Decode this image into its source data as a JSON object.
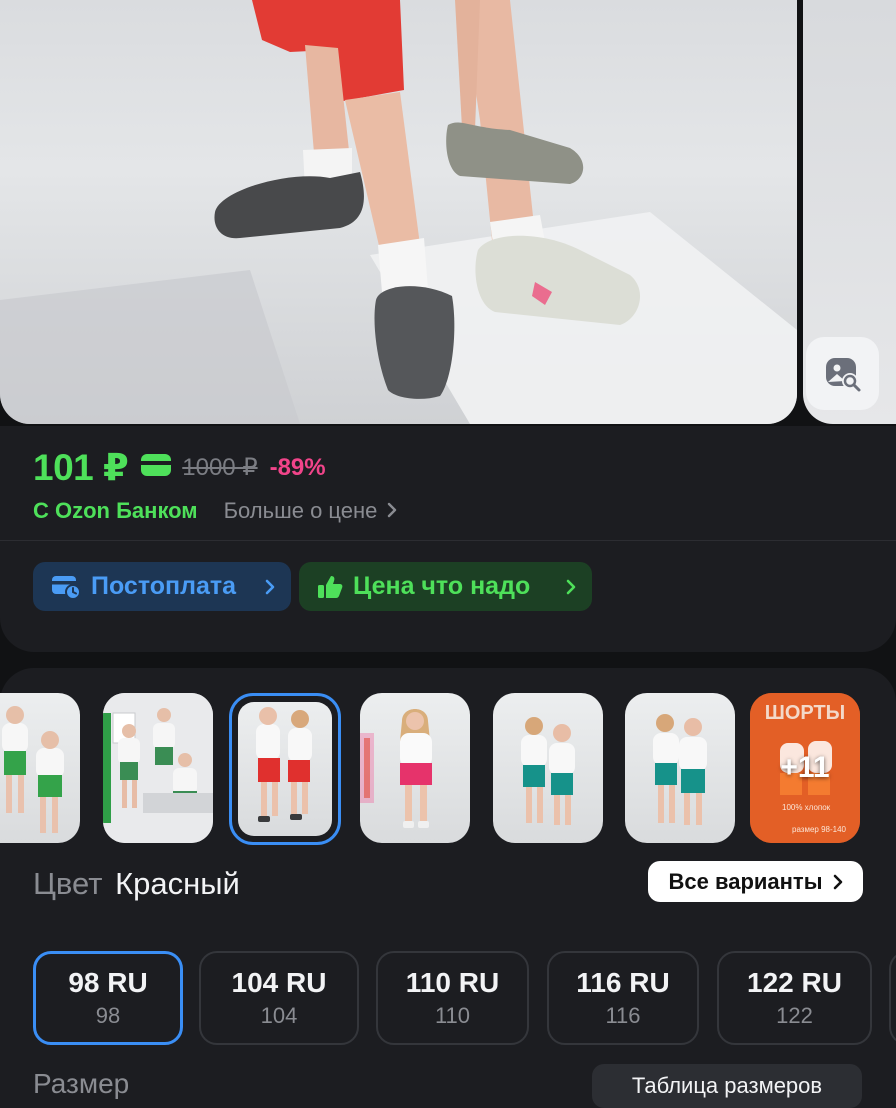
{
  "price": {
    "current": "101 ₽",
    "old": "1000 ₽",
    "discount": "-89%",
    "bank_label": "С Ozon Банком",
    "more_link": "Больше о цене"
  },
  "chips": {
    "postpay": "Постоплата",
    "good_price": "Цена что надо"
  },
  "variants": {
    "more_count": "+11",
    "promo_title": "ШОРТЫ",
    "promo_note1": "100% хлопок",
    "promo_note2": "размер 98-140",
    "color_label": "Цвет",
    "color_value": "Красный",
    "all_variants": "Все варианты"
  },
  "sizes": [
    {
      "main": "98 RU",
      "sub": "98",
      "selected": true
    },
    {
      "main": "104 RU",
      "sub": "104"
    },
    {
      "main": "110 RU",
      "sub": "110"
    },
    {
      "main": "116 RU",
      "sub": "116"
    },
    {
      "main": "122 RU",
      "sub": "122"
    }
  ],
  "size_label": "Размер",
  "size_table": "Таблица размеров",
  "colors": {
    "green_accent": "#4ee05a",
    "blue_accent": "#3a8ef5",
    "pink_discount": "#f1448a",
    "card_bg": "#1c1d21",
    "page_bg": "#111214"
  }
}
